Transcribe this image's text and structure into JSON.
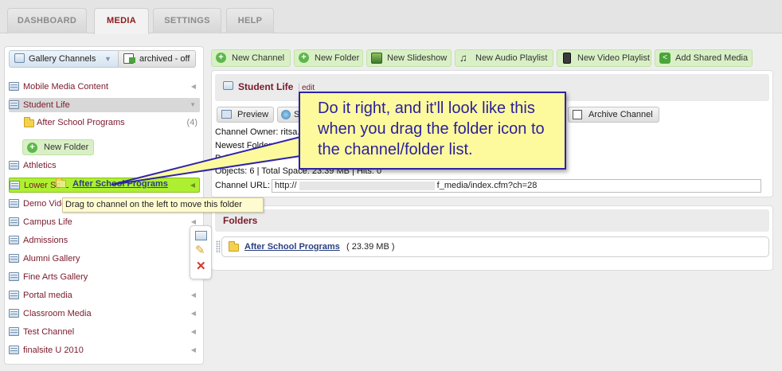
{
  "tabs": [
    {
      "label": "DASHBOARD"
    },
    {
      "label": "MEDIA"
    },
    {
      "label": "SETTINGS"
    },
    {
      "label": "HELP"
    }
  ],
  "sidebar": {
    "gallery_channels_label": "Gallery Channels",
    "archived_label": "archived - off",
    "items": [
      {
        "label": "Mobile Media Content"
      },
      {
        "label": "Student Life"
      },
      {
        "label": "After School Programs",
        "count": "(4)"
      },
      {
        "label": "Athletics"
      },
      {
        "label": "Lower Sc"
      },
      {
        "label": "Demo Vide"
      },
      {
        "label": "Campus Life"
      },
      {
        "label": "Admissions"
      },
      {
        "label": "Alumni Gallery"
      },
      {
        "label": "Fine Arts Gallery"
      },
      {
        "label": "Portal media"
      },
      {
        "label": "Classroom Media"
      },
      {
        "label": "Test Channel"
      },
      {
        "label": "finalsite U 2010"
      }
    ],
    "new_folder_label": "New Folder"
  },
  "toolbar": {
    "new_channel": "New Channel",
    "new_folder": "New Folder",
    "new_slideshow": "New Slideshow",
    "new_audio_playlist": "New Audio Playlist",
    "new_video_playlist": "New Video Playlist",
    "add_shared_media": "Add Shared Media"
  },
  "channel": {
    "title": "Student Life",
    "edit_label": "edit",
    "preview_label": "Preview",
    "s_label": "S",
    "archive_label": "Archive Channel",
    "owner": "Channel Owner: ritsa.",
    "newest_folder": "Newest Folder: After",
    "public": "Publ",
    "objects": "Objects: 6 | Total Space: 23.39 MB | Hits: 0",
    "url_label": "Channel URL:",
    "url_start": "http://",
    "url_end": "f_media/index.cfm?ch=28"
  },
  "folders": {
    "heading": "Folders",
    "rows": [
      {
        "name": "After School Programs",
        "size": "( 23.39 MB )"
      }
    ]
  },
  "callout": {
    "text": "Do it right, and it'll look like this when you drag the folder icon to the channel/folder list."
  },
  "drag": {
    "ghost_label": "After School Programs",
    "tooltip": "Drag to channel on the left to move this folder"
  },
  "colors": {
    "accent_maroon": "#7a1a2c",
    "drop_target_green": "#aef031",
    "callout_yellow": "#fdfa9e",
    "callout_border": "#2e24a8"
  }
}
